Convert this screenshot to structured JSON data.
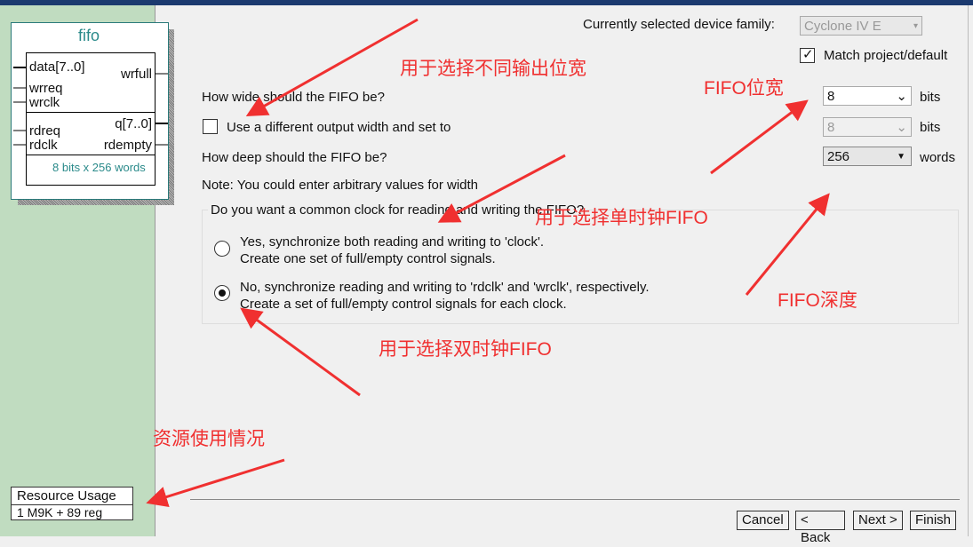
{
  "symbol": {
    "title": "fifo",
    "inputs": [
      "data[7..0]",
      "wrreq",
      "wrclk",
      "rdreq",
      "rdclk"
    ],
    "outputs": [
      "wrfull",
      "q[7..0]",
      "rdempty"
    ],
    "summary": "8 bits x 256 words"
  },
  "resource": {
    "label": "Resource Usage",
    "value": "1 M9K + 89 reg"
  },
  "device": {
    "label": "Currently selected device family:",
    "value": "Cyclone IV E",
    "match_label": "Match project/default",
    "match_checked": true
  },
  "width": {
    "question": "How wide should the FIFO be?",
    "value": "8",
    "unit": "bits",
    "diff_label": "Use a different output width and set to",
    "diff_value": "8",
    "diff_unit": "bits"
  },
  "depth": {
    "question": "How deep should the FIFO be?",
    "value": "256",
    "unit": "words"
  },
  "note": "Note: You could enter arbitrary values for width",
  "clock": {
    "legend": "Do you want a common clock for reading and writing the FIFO?",
    "options": [
      {
        "line1": "Yes, synchronize both reading and writing to 'clock'.",
        "line2": "Create one set of full/empty control signals.",
        "selected": false
      },
      {
        "line1": "No, synchronize reading and writing to 'rdclk' and 'wrclk', respectively.",
        "line2": "Create a set of full/empty control signals for each clock.",
        "selected": true
      }
    ]
  },
  "buttons": {
    "cancel": "Cancel",
    "back": "< Back",
    "next": "Next >",
    "finish": "Finish"
  },
  "annotations": {
    "output_width": "用于选择不同输出位宽",
    "fifo_width": "FIFO位宽",
    "single_clock": "用于选择单时钟FIFO",
    "fifo_depth": "FIFO深度",
    "dual_clock": "用于选择双时钟FIFO",
    "resource": "资源使用情况"
  },
  "colors": {
    "annotation": "#f03030",
    "teal": "#2a8a8a",
    "panel": "#c0dcc0"
  }
}
